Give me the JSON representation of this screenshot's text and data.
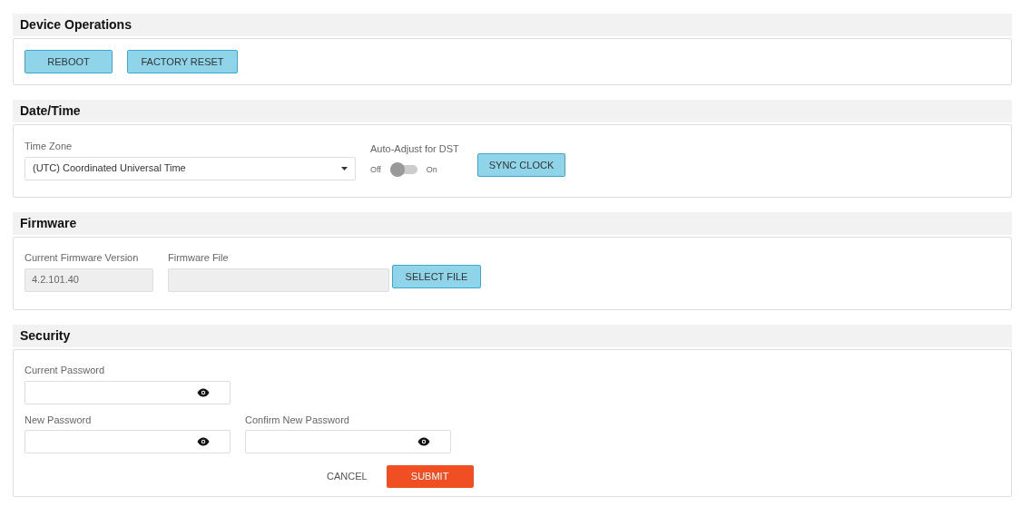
{
  "device_operations": {
    "title": "Device Operations",
    "buttons": [
      "REBOOT",
      "FACTORY RESET"
    ]
  },
  "date_time": {
    "title": "Date/Time",
    "time_zone": {
      "label": "Time Zone",
      "value": "(UTC) Coordinated Universal Time"
    },
    "dst": {
      "label": "Auto-Adjust for DST",
      "off_label": "Off",
      "on_label": "On",
      "on": false
    },
    "sync_button": "SYNC CLOCK"
  },
  "firmware": {
    "title": "Firmware",
    "version": {
      "label": "Current Firmware Version",
      "value": "4.2.101.40"
    },
    "file": {
      "label": "Firmware File"
    },
    "select_button": "SELECT FILE"
  },
  "security": {
    "title": "Security",
    "current_password": {
      "label": "Current Password"
    },
    "new_password": {
      "label": "New Password"
    },
    "confirm_password": {
      "label": "Confirm New Password"
    },
    "cancel_button": "CANCEL",
    "submit_button": "SUBMIT"
  }
}
